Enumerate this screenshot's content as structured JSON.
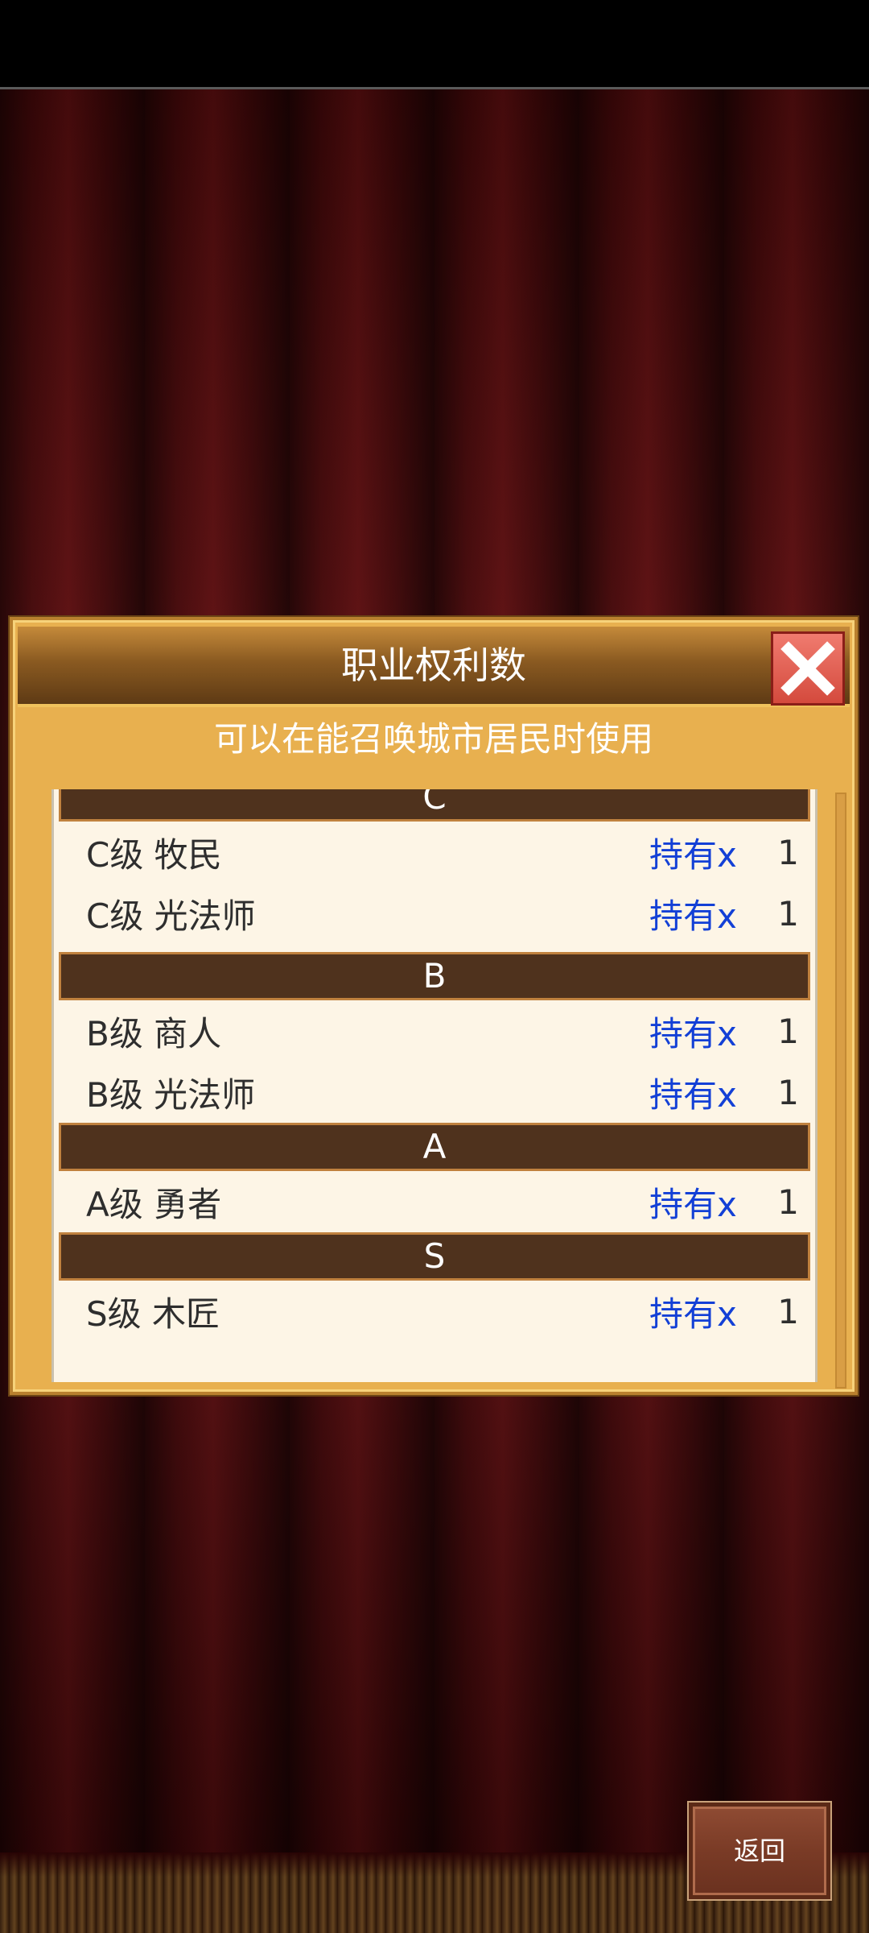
{
  "dialog": {
    "title": "职业权利数",
    "subtitle": "可以在能召唤城市居民时使用"
  },
  "groups": [
    {
      "header": "C",
      "items": [
        {
          "name": "C级 牧民",
          "held_label": "持有x",
          "count": "1"
        },
        {
          "name": "C级 光法师",
          "held_label": "持有x",
          "count": "1"
        }
      ]
    },
    {
      "header": "B",
      "items": [
        {
          "name": "B级 商人",
          "held_label": "持有x",
          "count": "1"
        },
        {
          "name": "B级 光法师",
          "held_label": "持有x",
          "count": "1"
        }
      ]
    },
    {
      "header": "A",
      "items": [
        {
          "name": "A级 勇者",
          "held_label": "持有x",
          "count": "1"
        }
      ]
    },
    {
      "header": "S",
      "items": [
        {
          "name": "S级 木匠",
          "held_label": "持有x",
          "count": "1"
        }
      ]
    }
  ],
  "footer": {
    "back_label": "返回"
  },
  "icons": {
    "close": "close-icon"
  },
  "colors": {
    "held_label": "#1340d6",
    "group_header_bg": "#4f321d",
    "dialog_bg": "#e8b04f",
    "close_button": "#e0574b"
  }
}
